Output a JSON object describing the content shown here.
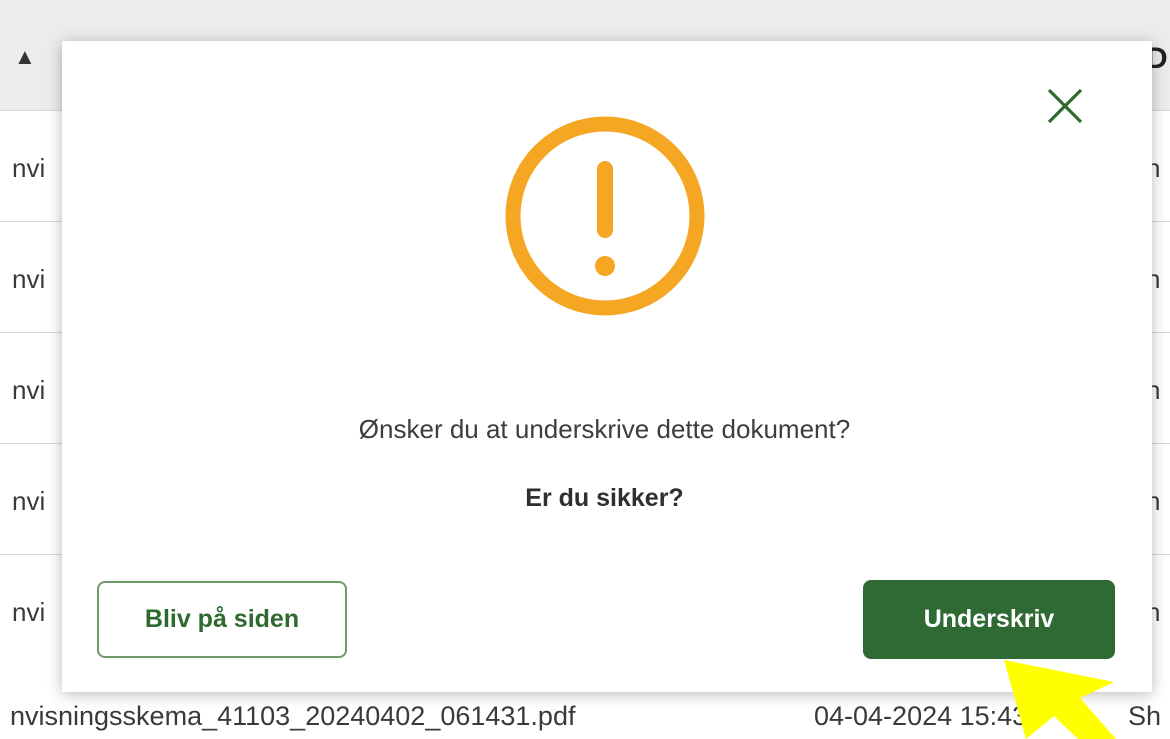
{
  "background": {
    "header_left": "▲",
    "header_right": "D",
    "row_left_text": "nvi",
    "row_right_text": "h",
    "rows": [
      "nvi",
      "nvi",
      "nvi",
      "nvi",
      "nvi"
    ],
    "last_row": {
      "filename": "nvisningsskema_41103_20240402_061431.pdf",
      "date": "04-04-2024 15:43",
      "owner": "Sh"
    }
  },
  "modal": {
    "question": "Ønsker du at underskrive dette dokument?",
    "confirm": "Er du sikker?",
    "stay_label": "Bliv på siden",
    "sign_label": "Underskriv"
  },
  "colors": {
    "accent_green": "#2f6a34",
    "warning_orange": "#f5a623",
    "close_green": "#2e6a30",
    "cursor_yellow": "#ffff00"
  },
  "icons": {
    "close": "close-icon",
    "warning": "warning-icon",
    "cursor": "mouse-pointer-icon"
  }
}
